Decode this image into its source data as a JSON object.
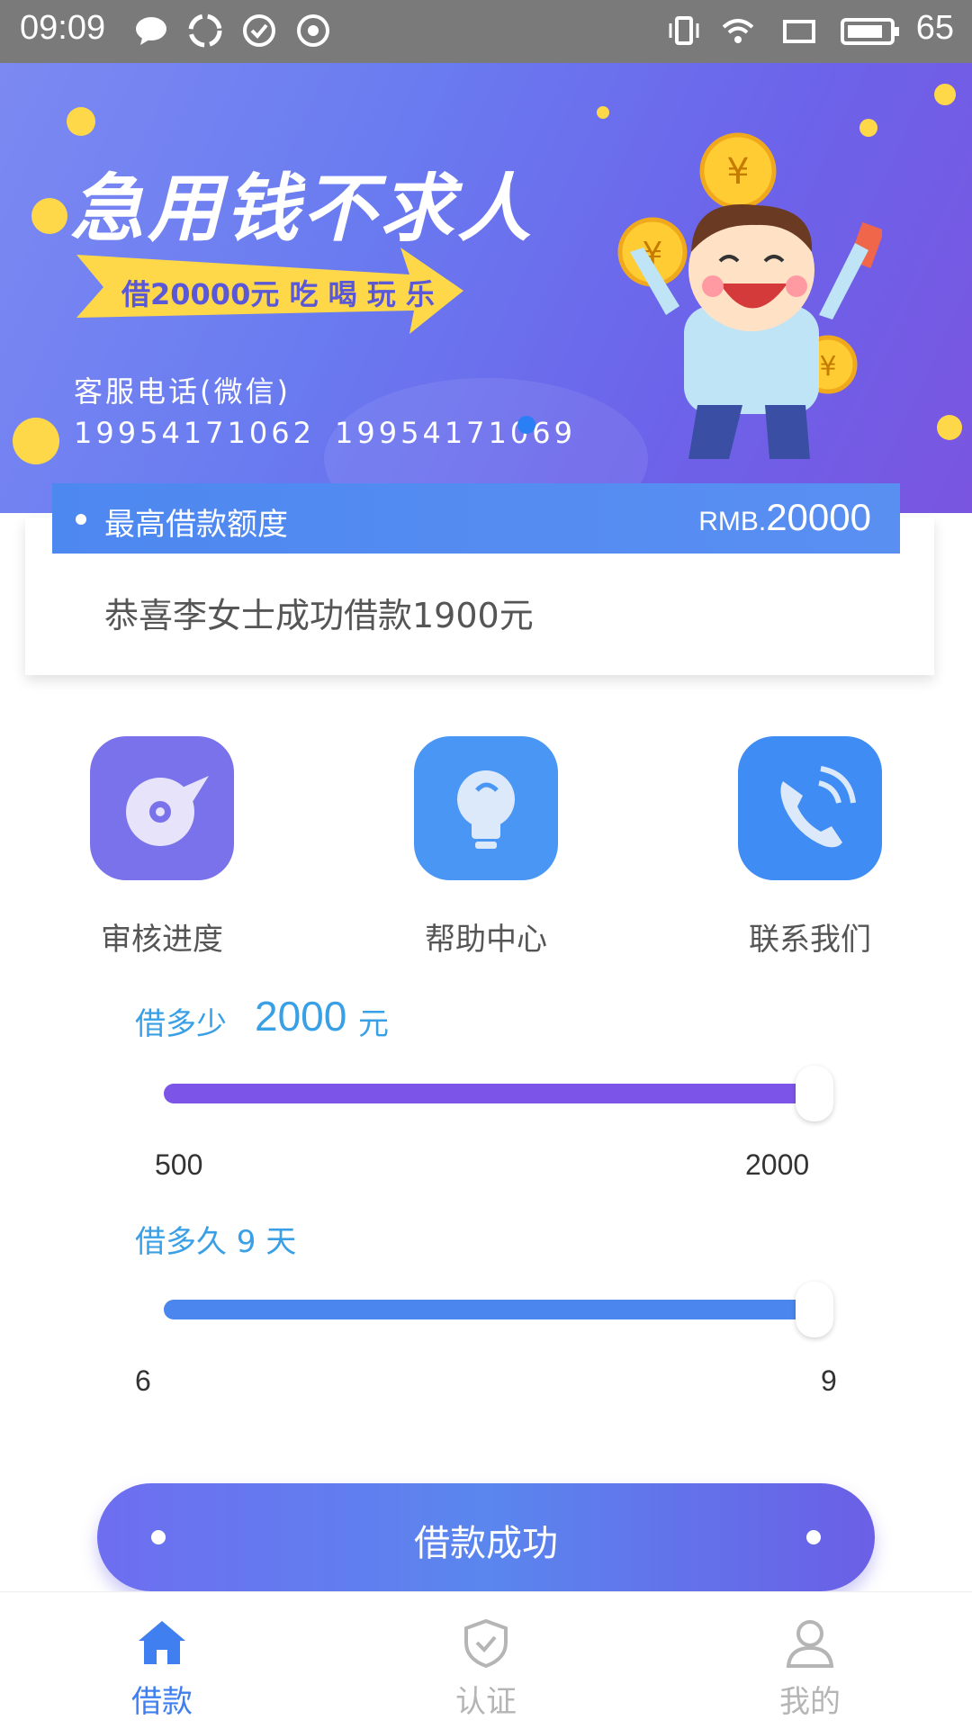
{
  "status_bar": {
    "time": "09:09",
    "battery": "65"
  },
  "banner": {
    "headline": "急用钱不求人",
    "arrow_text": "借20000元 吃 喝 玩 乐",
    "cs_label": "客服电话(微信)",
    "phone_1": "19954171062",
    "phone_2": "19954171069"
  },
  "quota": {
    "label": "最高借款额度",
    "prefix": "RMB.",
    "amount": "20000"
  },
  "notice": "恭喜李女士成功借款1900元",
  "actions": [
    {
      "label": "审核进度",
      "icon": "dial-icon",
      "color": "#7a72ea"
    },
    {
      "label": "帮助中心",
      "icon": "lightbulb-icon",
      "color": "#4a96f5"
    },
    {
      "label": "联系我们",
      "icon": "phone-icon",
      "color": "#3f8cf4"
    }
  ],
  "loan_amount": {
    "label": "借多少",
    "value": "2000",
    "unit": "元",
    "min": "500",
    "max": "2000",
    "fraction": 1.0,
    "color": "#7c55e8"
  },
  "loan_term": {
    "label": "借多久 9 天",
    "min": "6",
    "max": "9",
    "fraction": 1.0,
    "color": "#4a86ee"
  },
  "submit": {
    "label": "借款成功"
  },
  "nav": [
    {
      "label": "借款",
      "icon": "home-icon",
      "active": true
    },
    {
      "label": "认证",
      "icon": "shield-icon",
      "active": false
    },
    {
      "label": "我的",
      "icon": "user-icon",
      "active": false
    }
  ],
  "colors": {
    "accent_blue": "#3f7ff0",
    "nav_inactive": "#b5b5b5"
  }
}
